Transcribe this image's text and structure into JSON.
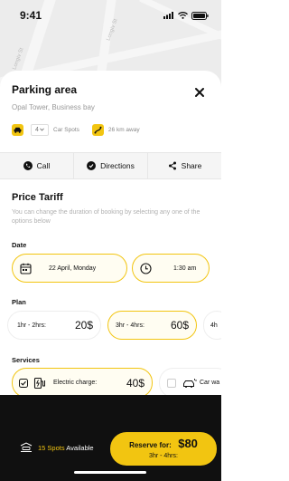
{
  "status": {
    "time": "9:41"
  },
  "map": {
    "labels": [
      "Longiv St",
      "Longiv St"
    ]
  },
  "parking": {
    "title": "Parking area",
    "address": "Opal Tower, Business bay",
    "spots_count": "4",
    "spots_label": "Car Spots",
    "distance": "26 km away"
  },
  "actions": {
    "call": "Call",
    "directions": "Directions",
    "share": "Share"
  },
  "tariff": {
    "title": "Price Tariff",
    "description": "You can change the duration of booking by selecting any one of the options below"
  },
  "date": {
    "label": "Date",
    "date_value": "22 April, Monday",
    "time_value": "1:30 am"
  },
  "plan": {
    "label": "Plan",
    "options": [
      {
        "duration": "1hr - 2hrs:",
        "price": "20$",
        "selected": false
      },
      {
        "duration": "3hr - 4hrs:",
        "price": "60$",
        "selected": true
      },
      {
        "duration": "4h",
        "price": "",
        "selected": false
      }
    ]
  },
  "services": {
    "label": "Services",
    "options": [
      {
        "name": "Electric charge:",
        "price": "40$",
        "selected": true
      },
      {
        "name": "Car wa",
        "price": "",
        "selected": false
      }
    ]
  },
  "footer": {
    "spots_count": "15 Spots",
    "spots_suffix": "Available",
    "reserve_label": "Reserve for:",
    "reserve_amount": "$80",
    "reserve_duration": "3hr - 4hrs:"
  },
  "colors": {
    "accent": "#f2c511",
    "dark": "#101010"
  }
}
